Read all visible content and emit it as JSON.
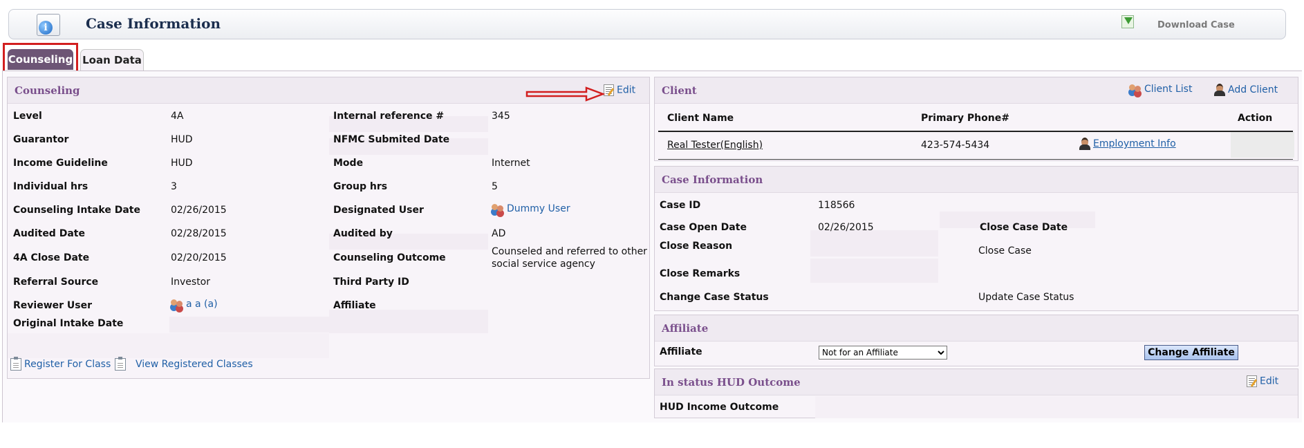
{
  "header": {
    "title": "Case Information",
    "download_label": "Download Case"
  },
  "tabs": [
    {
      "label": "Counseling",
      "active": true
    },
    {
      "label": "Loan Data",
      "active": false
    }
  ],
  "counseling": {
    "title": "Counseling",
    "edit_label": "Edit",
    "left_fields": [
      {
        "label": "Level",
        "value": "4A"
      },
      {
        "label": "Guarantor",
        "value": "HUD"
      },
      {
        "label": "Income Guideline",
        "value": "HUD"
      },
      {
        "label": "Individual hrs",
        "value": "3"
      },
      {
        "label": "Counseling Intake Date",
        "value": "02/26/2015"
      },
      {
        "label": "Audited Date",
        "value": "02/28/2015"
      },
      {
        "label": "4A Close Date",
        "value": "02/20/2015"
      },
      {
        "label": "Referral Source",
        "value": "Investor"
      },
      {
        "label": "Reviewer User",
        "value": "a a (a)"
      },
      {
        "label": "Original Intake Date",
        "value": ""
      }
    ],
    "right_fields": [
      {
        "label": "Internal reference #",
        "value": "345"
      },
      {
        "label": "NFMC Submited Date",
        "value": ""
      },
      {
        "label": "Mode",
        "value": "Internet"
      },
      {
        "label": "Group hrs",
        "value": "5"
      },
      {
        "label": "Designated User",
        "value": "Dummy User"
      },
      {
        "label": "Audited by",
        "value": "AD"
      },
      {
        "label": "Counseling Outcome",
        "value": "Counseled and referred to other social service agency"
      },
      {
        "label": "Third Party ID",
        "value": ""
      },
      {
        "label": "Affiliate",
        "value": ""
      }
    ],
    "register_label": "Register For Class",
    "view_classes_label": "View Registered Classes"
  },
  "client": {
    "title": "Client",
    "client_list_label": "Client List",
    "add_client_label": "Add Client",
    "columns": [
      "Client Name",
      "Primary Phone#",
      "Action"
    ],
    "rows": [
      {
        "name": "Real Tester(English)",
        "phone": "423-574-5434",
        "employment": "Employment Info"
      }
    ]
  },
  "case_info": {
    "title": "Case Information",
    "case_id_label": "Case ID",
    "case_id": "118566",
    "open_date_label": "Case Open Date",
    "open_date": "02/26/2015",
    "close_date_label": "Close Case Date",
    "close_reason_label": "Close Reason",
    "close_case_link": "Close Case",
    "close_remarks_label": "Close Remarks",
    "change_status_label": "Change Case Status",
    "update_status_link": "Update Case Status"
  },
  "affiliate": {
    "title": "Affiliate",
    "label": "Affiliate",
    "selected": "Not for an Affiliate",
    "button": "Change Affiliate"
  },
  "hud": {
    "title": "In status HUD Outcome",
    "edit_label": "Edit",
    "income_outcome_label": "HUD Income Outcome"
  },
  "colors": {
    "accent_tab": "#6d5575",
    "panel_title": "#7a4f8c",
    "link": "#1f5fa6",
    "highlight_red": "#d21f1f"
  }
}
